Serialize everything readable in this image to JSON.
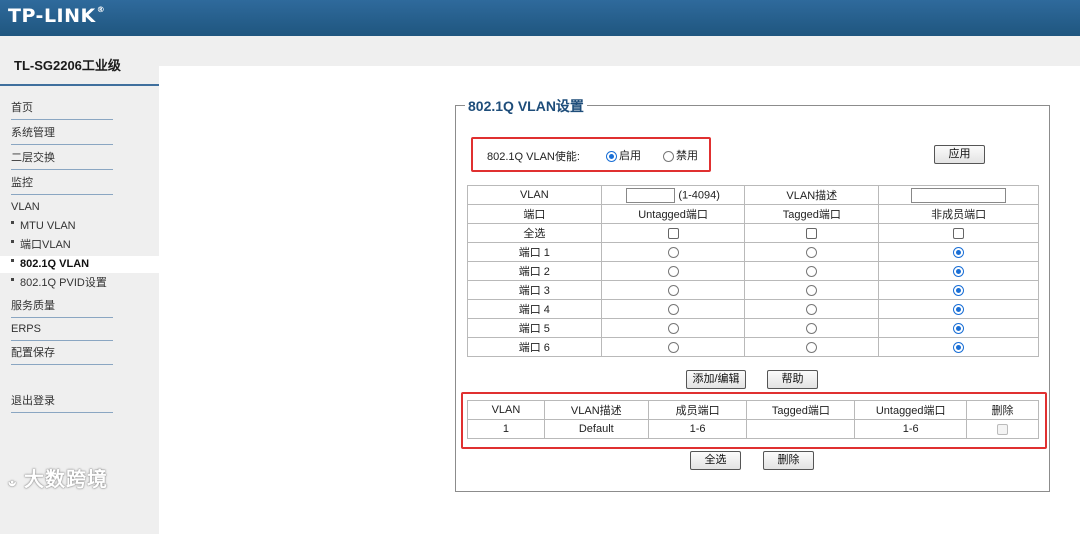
{
  "brand": {
    "logo": "TP-LINK",
    "reg": "®"
  },
  "device": {
    "model": "TL-SG2206工业级"
  },
  "sidebar": {
    "items": [
      {
        "label": "首页"
      },
      {
        "label": "系统管理"
      },
      {
        "label": "二层交换"
      },
      {
        "label": "监控"
      }
    ],
    "vlan_group": "VLAN",
    "sub_items": [
      {
        "label": "MTU VLAN"
      },
      {
        "label": "端口VLAN"
      },
      {
        "label": "802.1Q VLAN"
      },
      {
        "label": "802.1Q PVID设置"
      }
    ],
    "items2": [
      {
        "label": "服务质量"
      },
      {
        "label": "ERPS"
      },
      {
        "label": "配置保存"
      }
    ],
    "logout": "退出登录"
  },
  "watermark": "大数跨境",
  "panel": {
    "title": "802.1Q VLAN设置",
    "enable_label": "802.1Q VLAN使能:",
    "enable_on": "启用",
    "enable_off": "禁用",
    "enable_state": "启用",
    "apply_button": "应用"
  },
  "config_table": {
    "vlan_label": "VLAN",
    "vlan_range": "(1-4094)",
    "vlan_value": "",
    "desc_label": "VLAN描述",
    "desc_value": "",
    "headers": [
      "端口",
      "Untagged端口",
      "Tagged端口",
      "非成员端口"
    ],
    "select_all": "全选",
    "ports": [
      {
        "name": "端口 1",
        "mode": "非成员端口"
      },
      {
        "name": "端口 2",
        "mode": "非成员端口"
      },
      {
        "name": "端口 3",
        "mode": "非成员端口"
      },
      {
        "name": "端口 4",
        "mode": "非成员端口"
      },
      {
        "name": "端口 5",
        "mode": "非成员端口"
      },
      {
        "name": "端口 6",
        "mode": "非成员端口"
      }
    ],
    "add_button": "添加/编辑",
    "help_button": "帮助"
  },
  "vlan_list": {
    "headers": [
      "VLAN",
      "VLAN描述",
      "成员端口",
      "Tagged端口",
      "Untagged端口",
      "删除"
    ],
    "rows": [
      {
        "vlan": "1",
        "desc": "Default",
        "members": "1-6",
        "tagged": "",
        "untagged": "1-6"
      }
    ],
    "select_all_button": "全选",
    "delete_button": "删除"
  }
}
